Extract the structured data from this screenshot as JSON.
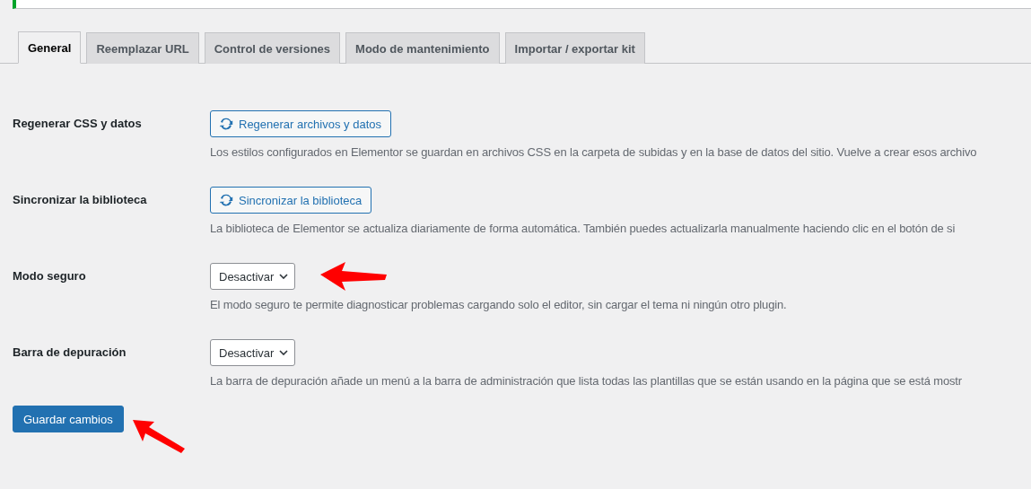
{
  "tabs": [
    {
      "label": "General",
      "selected": true
    },
    {
      "label": "Reemplazar URL",
      "selected": false
    },
    {
      "label": "Control de versiones",
      "selected": false
    },
    {
      "label": "Modo de mantenimiento",
      "selected": false
    },
    {
      "label": "Importar / exportar kit",
      "selected": false
    }
  ],
  "settings": [
    {
      "kind": "button",
      "label": "Regenerar CSS y datos",
      "control": "Regenerar archivos y datos",
      "description": "Los estilos configurados en Elementor se guardan en archivos CSS en la carpeta de subidas y en la base de datos del sitio. Vuelve a crear esos archivo",
      "annotated": false
    },
    {
      "kind": "button",
      "label": "Sincronizar la biblioteca",
      "control": "Sincronizar la biblioteca",
      "description": "La biblioteca de Elementor se actualiza diariamente de forma automática. También puedes actualizarla manualmente haciendo clic en el botón de si",
      "annotated": false
    },
    {
      "kind": "select",
      "label": "Modo seguro",
      "control": "Desactivar",
      "description": "El modo seguro te permite diagnosticar problemas cargando solo el editor, sin cargar el tema ni ningún otro plugin.",
      "annotated": true
    },
    {
      "kind": "select",
      "label": "Barra de depuración",
      "control": "Desactivar",
      "description": "La barra de depuración añade un menú a la barra de administración que lista todas las plantillas que se están usando en la página que se está mostr",
      "annotated": false
    }
  ],
  "save_button": {
    "label": "Guardar cambios",
    "annotated": true
  }
}
